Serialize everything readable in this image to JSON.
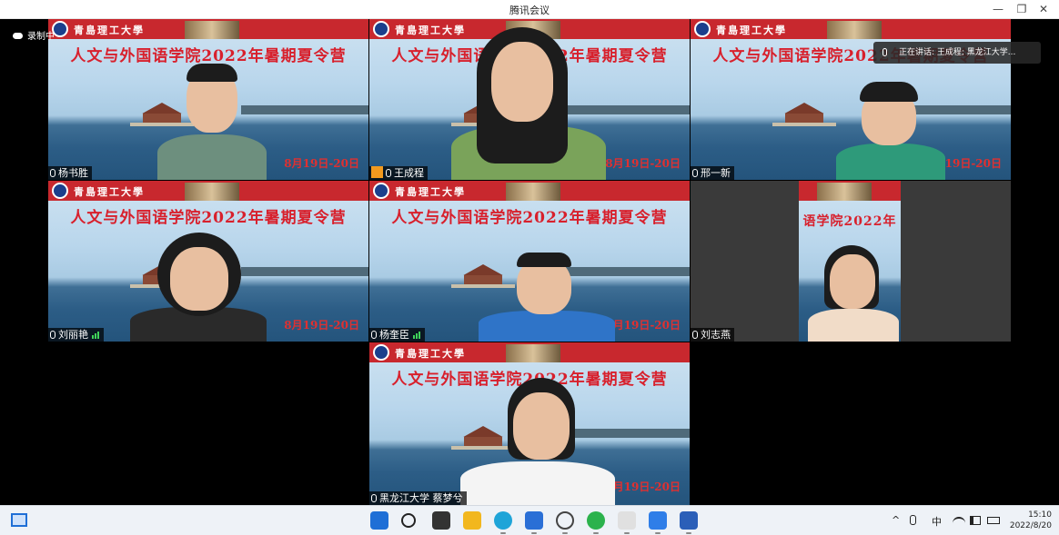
{
  "window": {
    "title": "腾讯会议",
    "minimize": "—",
    "restore": "❐",
    "close": "✕"
  },
  "recording": {
    "label": "录制中"
  },
  "speaking_bar": {
    "text": "正在讲话: 王成程; 黑龙江大学..."
  },
  "banner": {
    "university": "青島理工大學",
    "heading": "人文与外国语学院2022年暑期夏令营",
    "heading_cropped": "语学院2022年",
    "date": "8月19日-20日"
  },
  "participants": [
    {
      "name": "杨书胜",
      "signal": false
    },
    {
      "name": "王成程",
      "signal": false,
      "host": true
    },
    {
      "name": "邢一新",
      "signal": false
    },
    {
      "name": "刘丽艳",
      "signal": true
    },
    {
      "name": "杨奎臣",
      "signal": true
    },
    {
      "name": "刘志燕",
      "signal": false
    },
    {
      "name": "黑龙江大学 蔡梦兮",
      "signal": false
    }
  ],
  "taskbar": {
    "icons": [
      "start-icon",
      "search-icon",
      "task-view-icon",
      "file-explorer-icon",
      "edge-icon",
      "store-icon",
      "dell-icon",
      "wechat-icon",
      "qq-icon",
      "tencent-meeting-icon",
      "word-icon"
    ],
    "colors": [
      "#1f6fd6",
      "#222222",
      "#333333",
      "#f2b71e",
      "#1ea4d8",
      "#2a6fd6",
      "#444444",
      "#2bb24c",
      "#e0e0e0",
      "#2f7ee8",
      "#2b5fb8"
    ]
  },
  "tray": {
    "chevron": "^",
    "ime": "中",
    "time": "15:10",
    "date": "2022/8/20"
  }
}
